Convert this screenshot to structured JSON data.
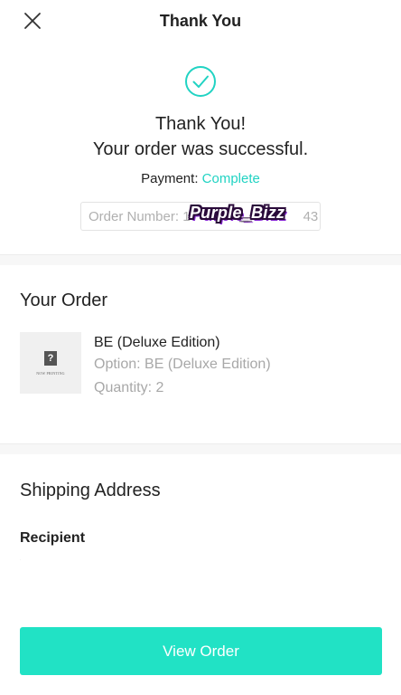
{
  "header": {
    "title": "Thank You",
    "close_icon": "close-icon"
  },
  "confirmation": {
    "icon": "check-circle-icon",
    "line1": "Thank You!",
    "line2": "Your order was successful.",
    "payment_label": "Payment:",
    "payment_status": "Complete",
    "order_number_label": "Order Number:",
    "order_number_value": "1                              43",
    "watermark": "Purple_Bizz"
  },
  "order": {
    "section_title": "Your Order",
    "product": {
      "thumbnail_mark": "?",
      "thumbnail_text": "NOW PRINTING",
      "name": "BE (Deluxe Edition)",
      "option": "Option: BE (Deluxe Edition)",
      "quantity": "Quantity: 2"
    }
  },
  "shipping": {
    "section_title": "Shipping Address",
    "recipient_label": "Recipient",
    "recipient_value": "·"
  },
  "actions": {
    "view_order_label": "View Order"
  },
  "colors": {
    "accent": "#21e2c5",
    "accent_text": "#21d3c3",
    "muted_text": "#a8a8a8"
  }
}
